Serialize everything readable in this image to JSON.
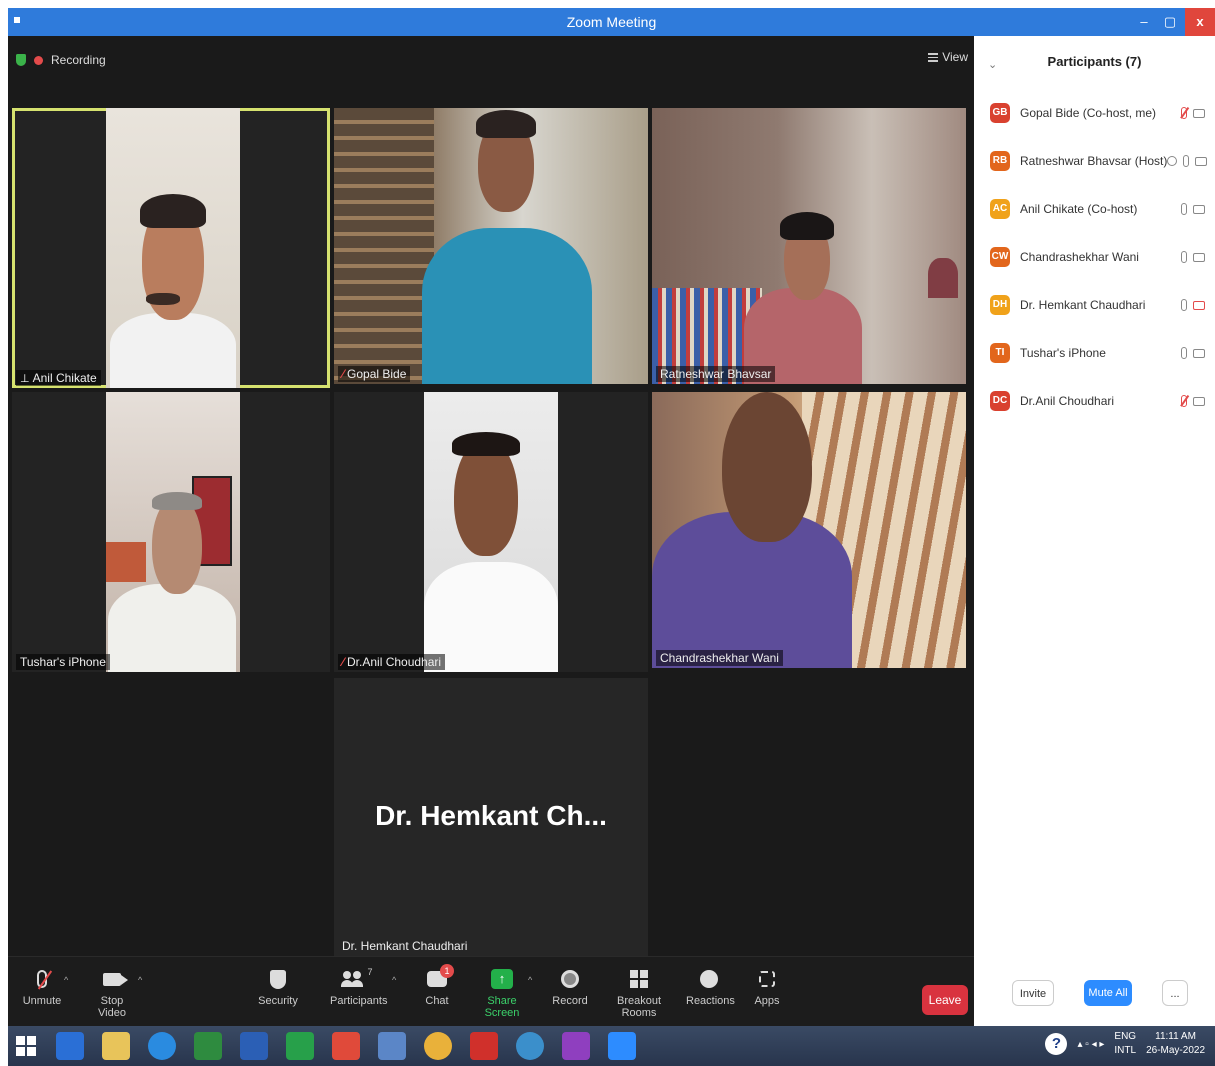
{
  "window": {
    "title": "Zoom Meeting",
    "min": "–",
    "max": "▢",
    "close": "x"
  },
  "status": {
    "recording": "Recording",
    "view": "View"
  },
  "tiles": [
    {
      "name": "Anil Chikate"
    },
    {
      "name": "Gopal Bide"
    },
    {
      "name": "Ratneshwar Bhavsar"
    },
    {
      "name": "Tushar's iPhone"
    },
    {
      "name": "Dr.Anil Choudhari"
    },
    {
      "name": "Chandrashekhar Wani"
    },
    {
      "name": "Dr. Hemkant Chaudhari",
      "display": "Dr. Hemkant Ch..."
    }
  ],
  "toolbar": {
    "unmute": "Unmute",
    "stop_video": "Stop Video",
    "security": "Security",
    "participants": "Participants",
    "participants_count": "7",
    "chat": "Chat",
    "chat_badge": "1",
    "share_screen": "Share Screen",
    "record": "Record",
    "breakout": "Breakout Rooms",
    "reactions": "Reactions",
    "apps": "Apps",
    "leave": "Leave"
  },
  "panel": {
    "title": "Participants (7)",
    "participants": [
      {
        "initials": "GB",
        "name": "Gopal Bide (Co-host, me)",
        "color": "#d9412f"
      },
      {
        "initials": "RB",
        "name": "Ratneshwar Bhavsar (Host)",
        "color": "#e2661c"
      },
      {
        "initials": "AC",
        "name": "Anil Chikate (Co-host)",
        "color": "#f0a21a"
      },
      {
        "initials": "CW",
        "name": "Chandrashekhar Wani",
        "color": "#e2661c"
      },
      {
        "initials": "DH",
        "name": "Dr. Hemkant Chaudhari",
        "color": "#f0a21a"
      },
      {
        "initials": "TI",
        "name": "Tushar's iPhone",
        "color": "#e2661c"
      },
      {
        "initials": "DC",
        "name": "Dr.Anil Choudhari",
        "color": "#d9412f"
      }
    ],
    "invite": "Invite",
    "mute_all": "Mute All",
    "more": "..."
  },
  "taskbar": {
    "lang1": "ENG",
    "lang2": "INTL",
    "time": "11:11 AM",
    "date": "26-May-2022",
    "help": "?"
  }
}
